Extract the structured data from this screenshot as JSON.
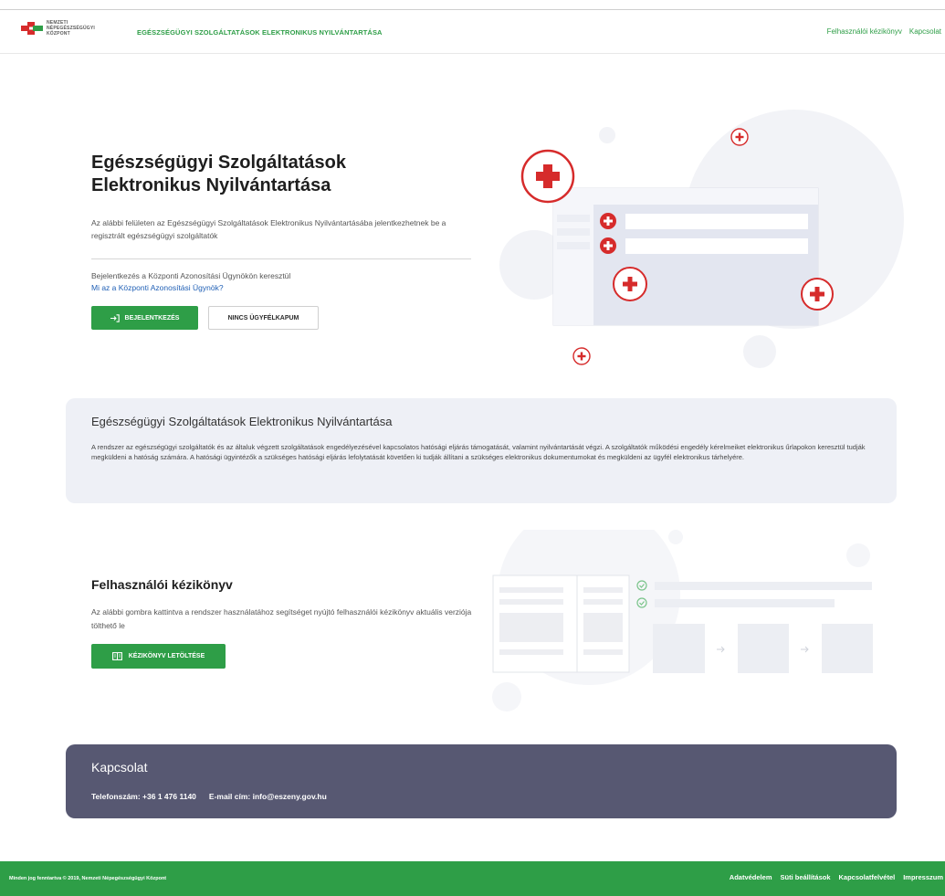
{
  "header": {
    "logo_lines": [
      "NEMZETI",
      "NÉPEGÉSZSÉGÜGYI",
      "KÖZPONT"
    ],
    "app_title": "EGÉSZSÉGÜGYI SZOLGÁLTATÁSOK ELEKTRONIKUS NYILVÁNTARTÁSA",
    "nav": [
      "Felhasználói kézikönyv",
      "Kapcsolat"
    ]
  },
  "hero": {
    "title": "Egészségügyi Szolgáltatások Elektronikus Nyilvántartása",
    "description": "Az alábbi felületen az Egészségügyi Szolgáltatások Elektronikus Nyilvántartásába jelentkezhetnek be a regisztrált egészségügyi szolgáltatók",
    "login_via": "Bejelentkezés a Központi Azonosítási Ügynökön keresztül",
    "kau_link": "Mi az a Központi Azonosítási Ügynök?",
    "login_button": "BEJELENTKEZÉS",
    "no_client_button": "NINCS ÜGYFÉLKAPUM"
  },
  "info": {
    "title": "Egészségügyi Szolgáltatások Elektronikus Nyilvántartása",
    "text": "A rendszer az egészségügyi szolgáltatók és az általuk végzett szolgáltatások engedélyezésével kapcsolatos hatósági eljárás támogatását, valamint nyilvántartását végzi. A szolgáltatók működési engedély kérelmeiket elektronikus űrlapokon keresztül tudják megküldeni a hatóság számára. A hatósági ügyintézők a szükséges hatósági eljárás lefolytatását követően ki tudják állítani a szükséges elektronikus dokumentumokat és megküldeni az ügyfél elektronikus tárhelyére."
  },
  "manual": {
    "title": "Felhasználói kézikönyv",
    "description": "Az alábbi gombra kattintva a rendszer használatához segítséget nyújtó felhasználói kézikönyv aktuális verziója tölthető le",
    "download_button": "KÉZIKÖNYV LETÖLTÉSE"
  },
  "contact": {
    "title": "Kapcsolat",
    "phone": "Telefonszám: +36 1 476 1140",
    "email": "E-mail cím: info@eszeny.gov.hu"
  },
  "footer": {
    "copyright": "Minden jog fenntartva © 2019, Nemzeti Népegészségügyi Központ",
    "links": [
      "Adatvédelem",
      "Süti beállítások",
      "Kapcsolatfelvétel",
      "Impresszum"
    ]
  },
  "colors": {
    "primary_green": "#2e9e47",
    "accent_red": "#d62b2b",
    "panel_bg": "#eef0f6",
    "contact_bg": "#575872"
  }
}
